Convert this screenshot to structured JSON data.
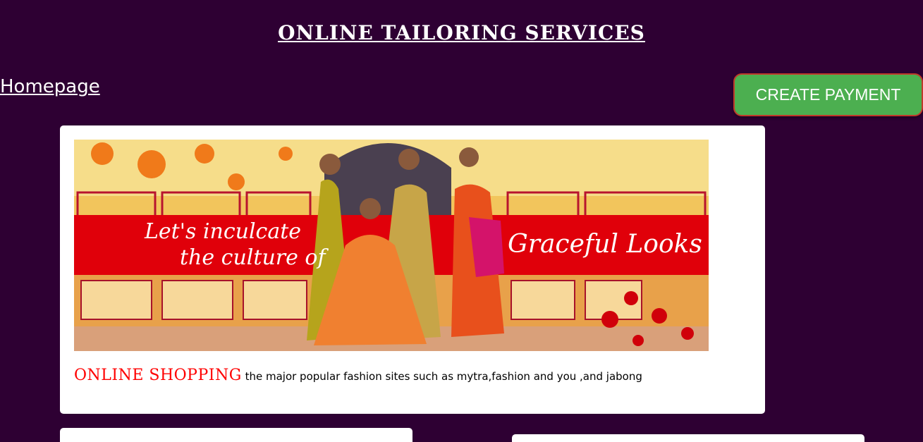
{
  "header": {
    "title": "ONLINE TAILORING SERVICES"
  },
  "nav": {
    "home_label": "Homepage"
  },
  "actions": {
    "create_payment_label": "CREATE PAYMENT"
  },
  "featured": {
    "banner": {
      "left_line_1": "Let's inculcate",
      "left_line_2": "the culture of",
      "right_text": "Graceful Looks"
    },
    "highlight": "ONLINE SHOPPING",
    "description": "the major popular fashion sites such as mytra,fashion and you ,and jabong"
  },
  "colors": {
    "background": "#2e0033",
    "button": "#4caf50",
    "button_border": "#c0392b",
    "highlight": "#ff0000",
    "banner_red": "#e0000a"
  }
}
